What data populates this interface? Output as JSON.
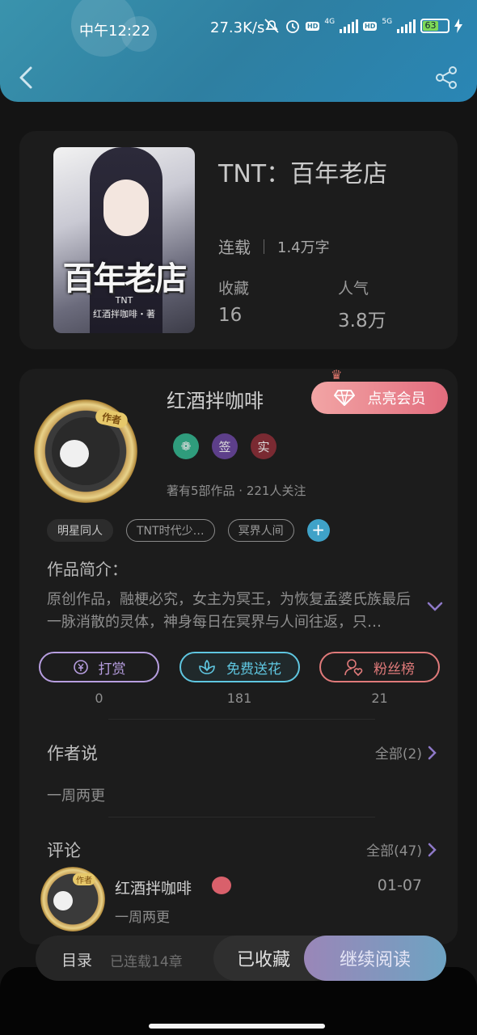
{
  "status_bar": {
    "time": "中午12:22",
    "speed": "27.3K/s",
    "battery": "63",
    "net_4g": "4G",
    "net_5g": "5G",
    "hd": "HD"
  },
  "book": {
    "title": "TNT：百年老店",
    "cover_title": "百年老店",
    "cover_series": "TNT",
    "cover_author": "红酒拌咖啡・著",
    "status": "连载",
    "word_count": "1.4万字",
    "collect_label": "收藏",
    "collect_value": "16",
    "popularity_label": "人气",
    "popularity_value": "3.8万"
  },
  "author": {
    "tag": "作者",
    "name": "红酒拌咖啡",
    "vip_button": "点亮会员",
    "badges": [
      "签",
      "实"
    ],
    "meta": "著有5部作品 · 221人关注"
  },
  "tags": [
    "明星同人",
    "TNT时代少…",
    "冥界人间"
  ],
  "intro": {
    "title": "作品简介：",
    "text": "原创作品，融梗必究，女主为冥王，为恢复孟婆氏族最后一脉消散的灵体，神身每日在冥界与人间往返，只…"
  },
  "actions": [
    {
      "label": "打赏",
      "count": "0"
    },
    {
      "label": "免费送花",
      "count": "181"
    },
    {
      "label": "粉丝榜",
      "count": "21"
    }
  ],
  "author_say": {
    "title": "作者说",
    "link": "全部(2)",
    "text": "一周两更"
  },
  "comments": {
    "title": "评论",
    "link": "全部(47)",
    "items": [
      {
        "avatar_tag": "作者",
        "name": "红酒拌咖啡",
        "date": "01-07",
        "text": "一周两更"
      }
    ]
  },
  "bottom_bar": {
    "toc": "目录",
    "toc_status": "已连载14章",
    "collected": "已收藏",
    "continue": "继续阅读"
  },
  "colors": {
    "header": "#2e7fa1",
    "vip": "#e26c7d",
    "accent_blue": "#3fa2c8",
    "reward": "#b79ee0",
    "flower": "#5fc6e0",
    "fans": "#e07a7a"
  }
}
